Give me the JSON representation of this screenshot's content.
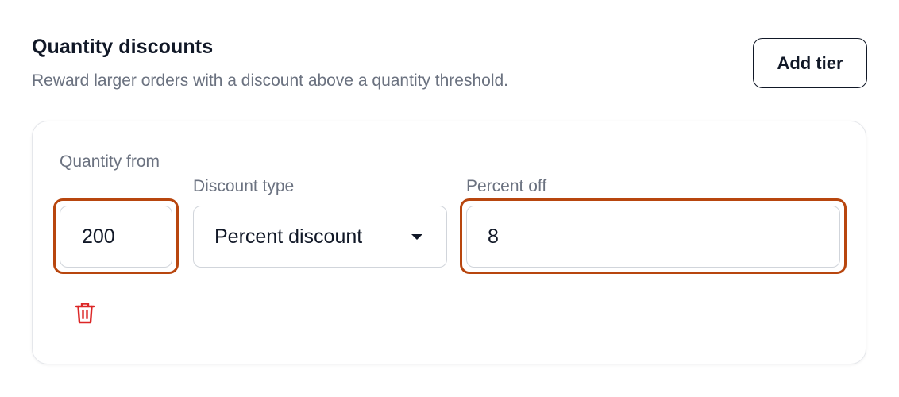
{
  "section": {
    "title": "Quantity discounts",
    "description": "Reward larger orders with a discount above a quantity threshold.",
    "add_tier_label": "Add tier"
  },
  "tier": {
    "quantity_label": "Quantity from",
    "quantity_value": "200",
    "discount_type_label": "Discount type",
    "discount_type_value": "Percent discount",
    "percent_label": "Percent off",
    "percent_value": "8"
  },
  "colors": {
    "focus_ring": "#b8460e",
    "delete_icon": "#dc2626",
    "muted_text": "#6b7280"
  },
  "icons": {
    "delete": "trash-icon",
    "dropdown": "chevron-down-icon"
  }
}
